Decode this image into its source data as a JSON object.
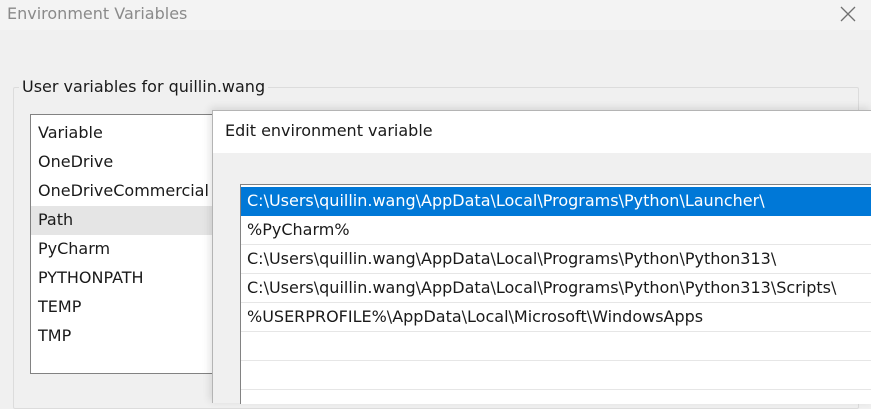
{
  "env_window": {
    "title": "Environment Variables",
    "group_label": "User variables for quillin.wang",
    "variable_header": "Variable",
    "variables": [
      {
        "name": "OneDrive"
      },
      {
        "name": "OneDriveCommercial"
      },
      {
        "name": "Path",
        "selected": true
      },
      {
        "name": "PyCharm"
      },
      {
        "name": "PYTHONPATH"
      },
      {
        "name": "TEMP"
      },
      {
        "name": "TMP"
      }
    ]
  },
  "edit_dialog": {
    "title": "Edit environment variable",
    "entries": [
      {
        "value": "C:\\Users\\quillin.wang\\AppData\\Local\\Programs\\Python\\Launcher\\",
        "selected": true
      },
      {
        "value": "%PyCharm%"
      },
      {
        "value": "C:\\Users\\quillin.wang\\AppData\\Local\\Programs\\Python\\Python313\\"
      },
      {
        "value": "C:\\Users\\quillin.wang\\AppData\\Local\\Programs\\Python\\Python313\\Scripts\\"
      },
      {
        "value": "%USERPROFILE%\\AppData\\Local\\Microsoft\\WindowsApps"
      }
    ]
  },
  "colors": {
    "selection": "#0078d7",
    "selected_row_gray": "#e5e5e5"
  },
  "icons": [
    "close-icon"
  ]
}
